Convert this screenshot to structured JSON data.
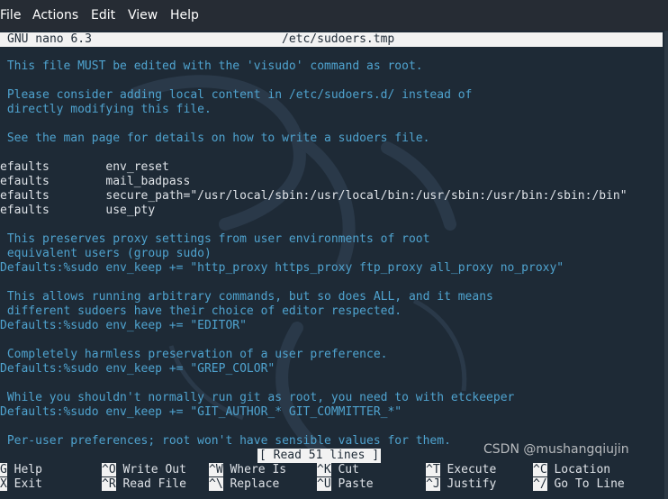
{
  "menubar": {
    "items": [
      "File",
      "Actions",
      "Edit",
      "View",
      "Help"
    ]
  },
  "nano": {
    "version": "GNU nano 6.3",
    "filename": "/etc/sudoers.tmp"
  },
  "lines": [
    " This file MUST be edited with the 'visudo' command as root.",
    " Please consider adding local content in /etc/sudoers.d/ instead of",
    " directly modifying this file.",
    " See the man page for details on how to write a sudoers file.",
    "efaults        env_reset",
    "efaults        mail_badpass",
    "efaults        secure_path=\"/usr/local/sbin:/usr/local/bin:/usr/sbin:/usr/bin:/sbin:/bin\"",
    "efaults        use_pty",
    " This preserves proxy settings from user environments of root",
    " equivalent users (group sudo)",
    "Defaults:%sudo env_keep += \"http_proxy https_proxy ftp_proxy all_proxy no_proxy\"",
    " This allows running arbitrary commands, but so does ALL, and it means",
    " different sudoers have their choice of editor respected.",
    "Defaults:%sudo env_keep += \"EDITOR\"",
    " Completely harmless preservation of a user preference.",
    "Defaults:%sudo env_keep += \"GREP_COLOR\"",
    " While you shouldn't normally run git as root, you need to with etckeeper",
    "Defaults:%sudo env_keep += \"GIT_AUTHOR_* GIT_COMMITTER_*\"",
    " Per-user preferences; root won't have sensible values for them."
  ],
  "status_message": "[ Read 51 lines ]",
  "shortcuts": [
    {
      "key": "G",
      "label": " Help"
    },
    {
      "key": "^O",
      "label": " Write Out"
    },
    {
      "key": "^W",
      "label": " Where Is"
    },
    {
      "key": "^K",
      "label": " Cut"
    },
    {
      "key": "^T",
      "label": " Execute"
    },
    {
      "key": "^C",
      "label": " Location"
    },
    {
      "key": "X",
      "label": " Exit"
    },
    {
      "key": "^R",
      "label": " Read File"
    },
    {
      "key": "^\\",
      "label": " Replace"
    },
    {
      "key": "^U",
      "label": " Paste"
    },
    {
      "key": "^J",
      "label": " Justify"
    },
    {
      "key": "^/",
      "label": " Go To Line"
    }
  ],
  "watermark": "CSDN @mushangqiujin",
  "colors": {
    "background": "#1e2a36",
    "comment": "#4fa3cf",
    "text": "#dfe3e8",
    "bar": "#f2f2f2"
  }
}
